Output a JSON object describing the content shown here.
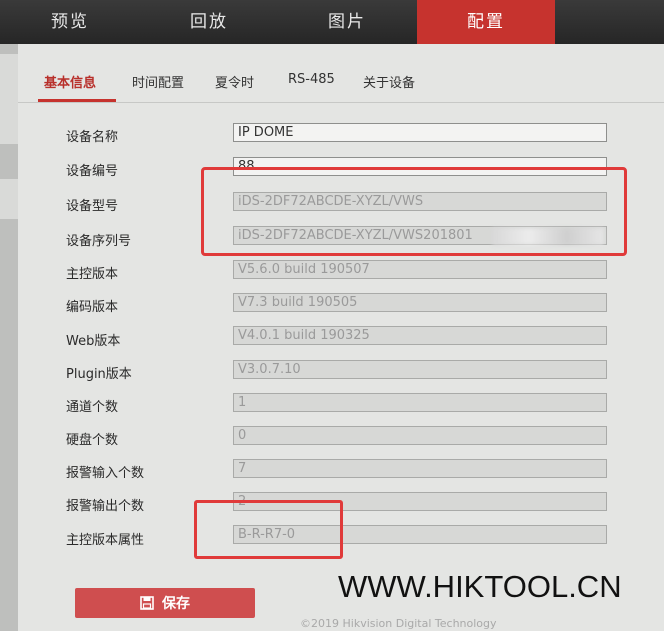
{
  "nav": {
    "tabs": [
      {
        "label": "预览"
      },
      {
        "label": "回放"
      },
      {
        "label": "图片"
      },
      {
        "label": "配置"
      }
    ],
    "active_index": 3
  },
  "subtabs": [
    {
      "label": "基本信息"
    },
    {
      "label": "时间配置"
    },
    {
      "label": "夏令时"
    },
    {
      "label": "RS-485"
    },
    {
      "label": "关于设备"
    }
  ],
  "device_info": [
    {
      "label": "设备名称",
      "value": "IP DOME"
    },
    {
      "label": "设备编号",
      "value": "88"
    },
    {
      "label": "设备型号",
      "value": "iDS-2DF72ABCDE-XYZL/VWS"
    },
    {
      "label": "设备序列号",
      "value": "iDS-2DF72ABCDE-XYZL/VWS201801"
    },
    {
      "label": "主控版本",
      "value": "V5.6.0 build 190507"
    },
    {
      "label": "编码版本",
      "value": "V7.3 build 190505"
    },
    {
      "label": "Web版本",
      "value": "V4.0.1 build 190325"
    },
    {
      "label": "Plugin版本",
      "value": "V3.0.7.10"
    },
    {
      "label": "通道个数",
      "value": "1"
    },
    {
      "label": "硬盘个数",
      "value": "0"
    },
    {
      "label": "报警输入个数",
      "value": "7"
    },
    {
      "label": "报警输出个数",
      "value": "2"
    },
    {
      "label": "主控版本属性",
      "value": "B-R-R7-0"
    }
  ],
  "save_button": {
    "label": "保存",
    "icon": "floppy-disk-icon"
  },
  "watermark": "WWW.HIKTOOL.CN",
  "footer": "©2019 Hikvision Digital Technology",
  "colors": {
    "accent": "#c6332e",
    "highlight": "#e03a3a",
    "button": "#cf4e4f"
  }
}
